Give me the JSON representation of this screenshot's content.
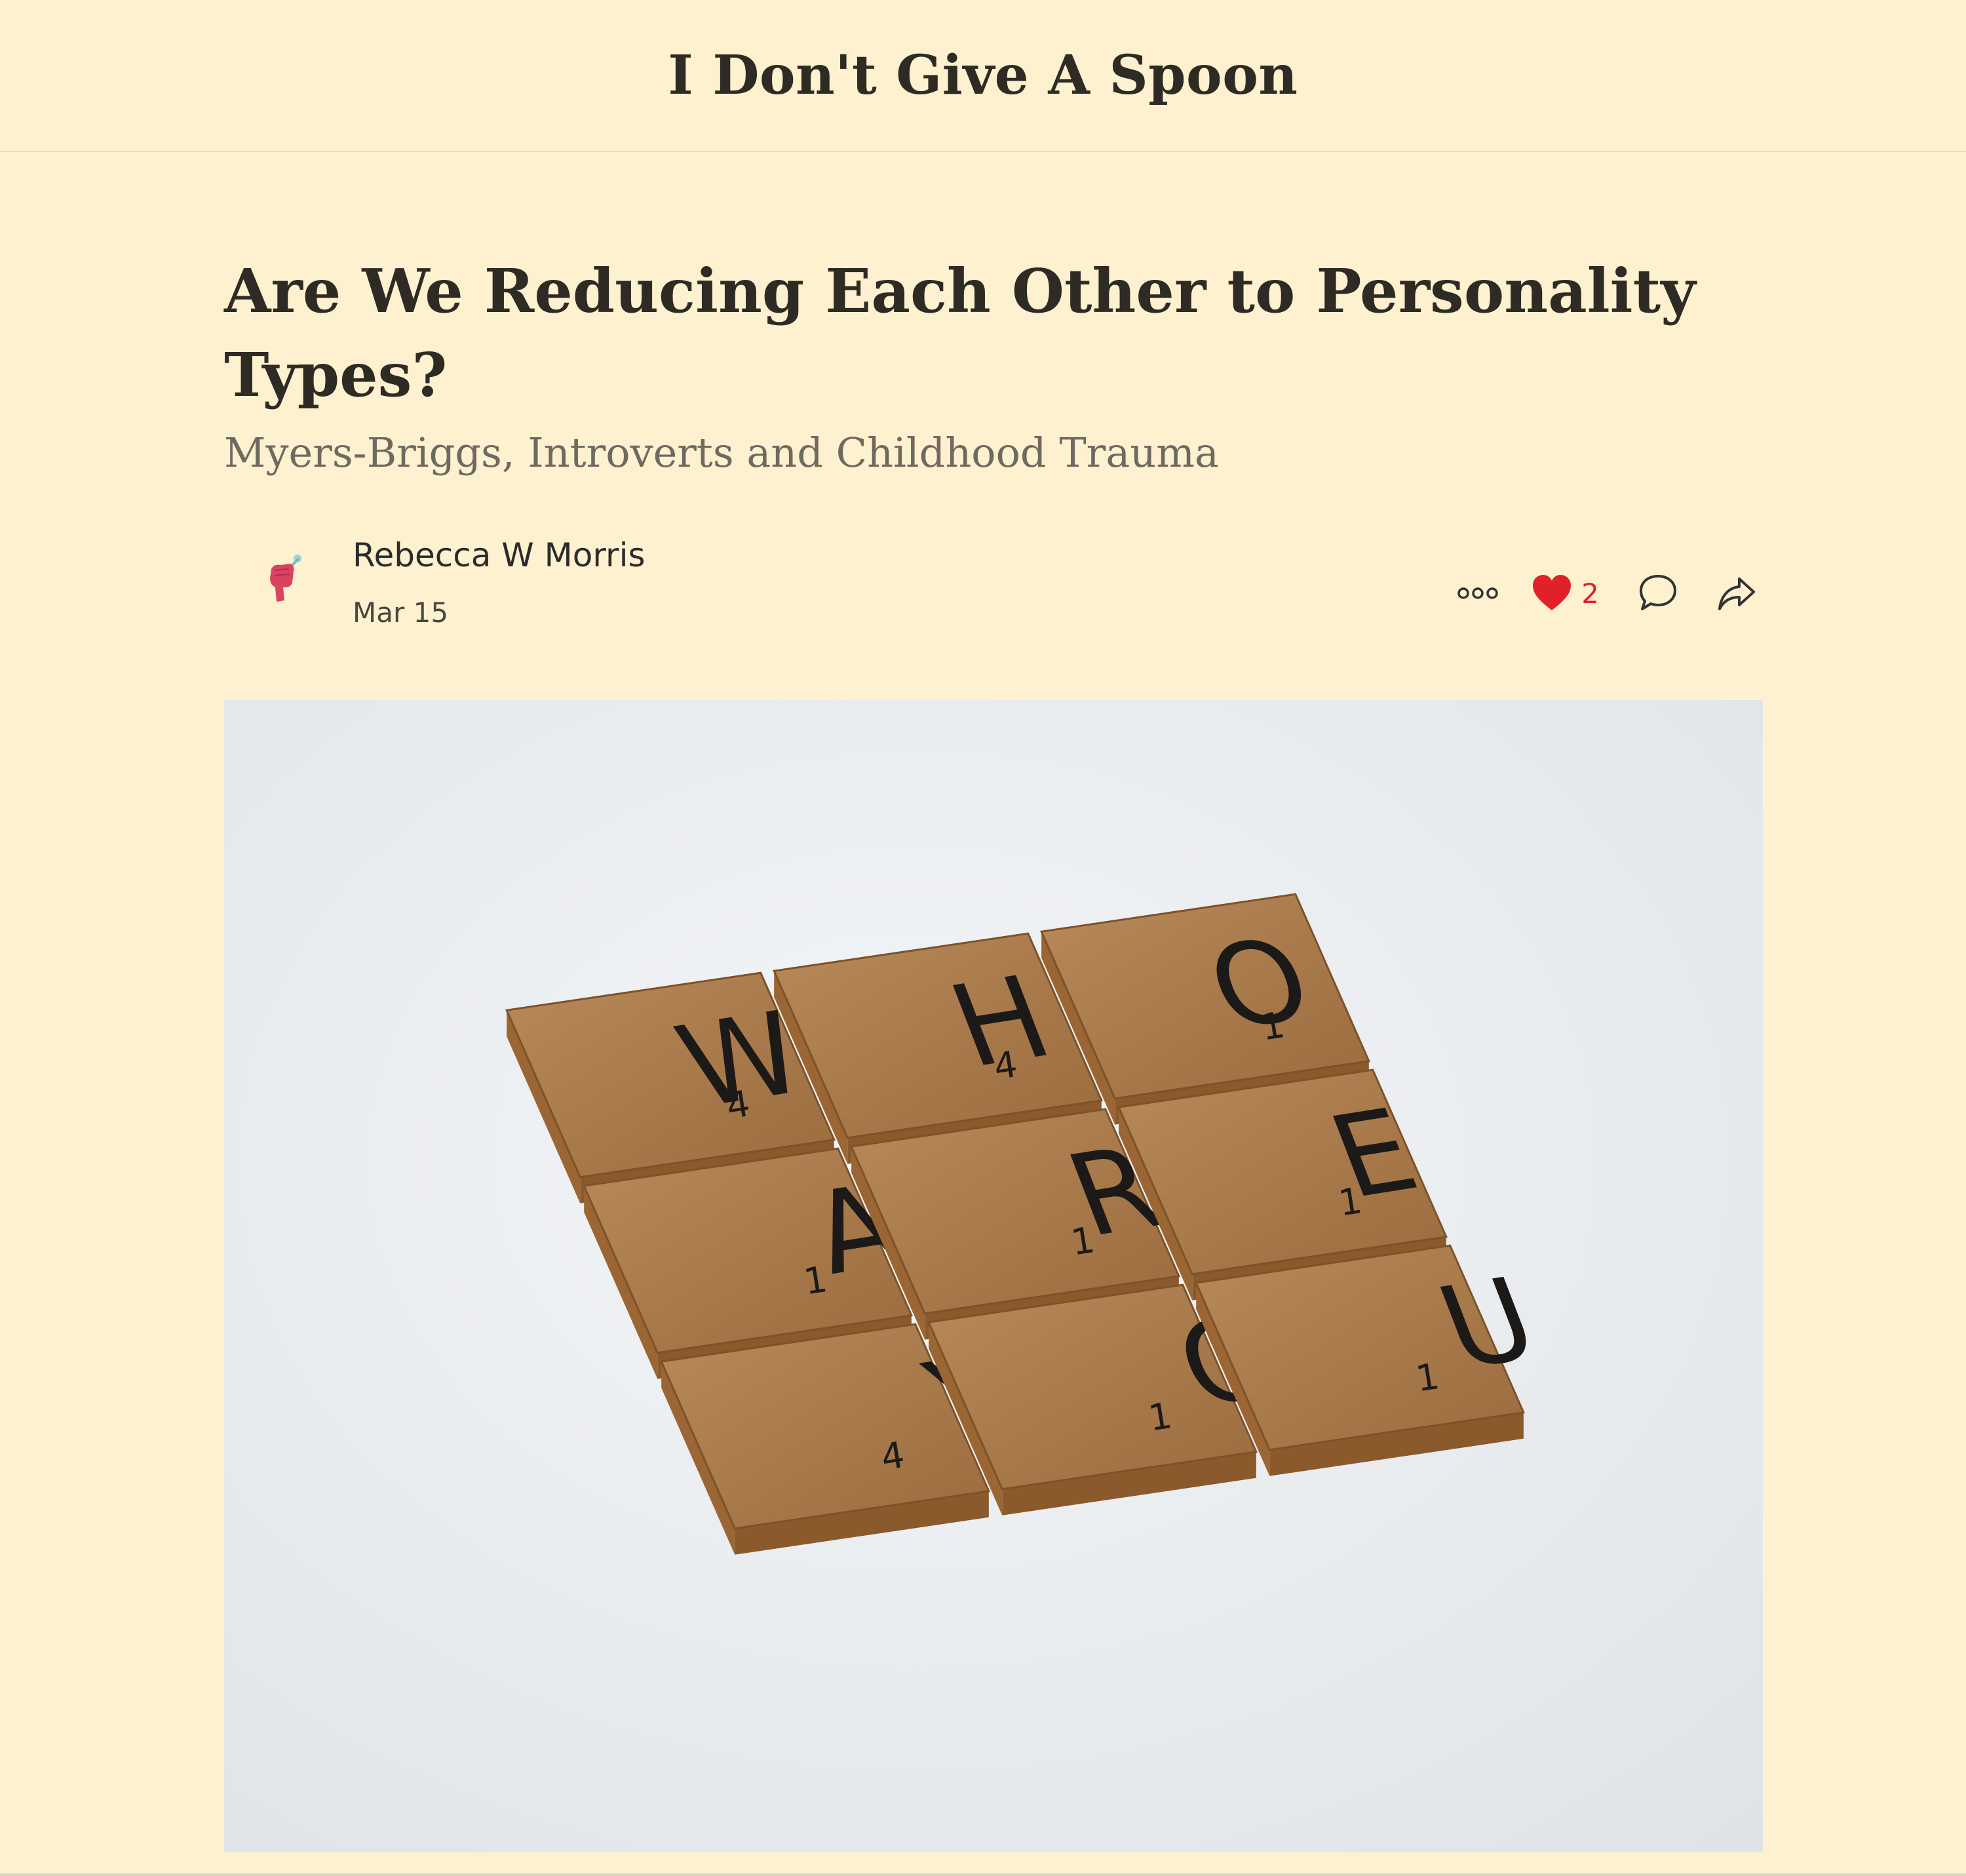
{
  "publication": {
    "name": "I Don't Give A Spoon"
  },
  "post": {
    "title": "Are We Reducing Each Other to Personality Types?",
    "subtitle": "Myers-Briggs, Introverts and Childhood Trauma",
    "author": "Rebecca W Morris",
    "date": "Mar 15",
    "like_count": "2"
  },
  "icons": {
    "more": "more-dots-icon",
    "like": "heart-icon",
    "comment": "comment-bubble-icon",
    "share": "share-arrow-icon"
  },
  "colors": {
    "background": "#fef1cf",
    "like": "#e1212a",
    "text": "#2e2b25"
  },
  "hero": {
    "tiles": [
      {
        "letter": "W",
        "score": "4"
      },
      {
        "letter": "H",
        "score": "4"
      },
      {
        "letter": "O",
        "score": "1"
      },
      {
        "letter": "A",
        "score": "1"
      },
      {
        "letter": "R",
        "score": "1"
      },
      {
        "letter": "E",
        "score": "1"
      },
      {
        "letter": "Y",
        "score": "4"
      },
      {
        "letter": "O",
        "score": "1"
      },
      {
        "letter": "U",
        "score": "1"
      }
    ]
  }
}
